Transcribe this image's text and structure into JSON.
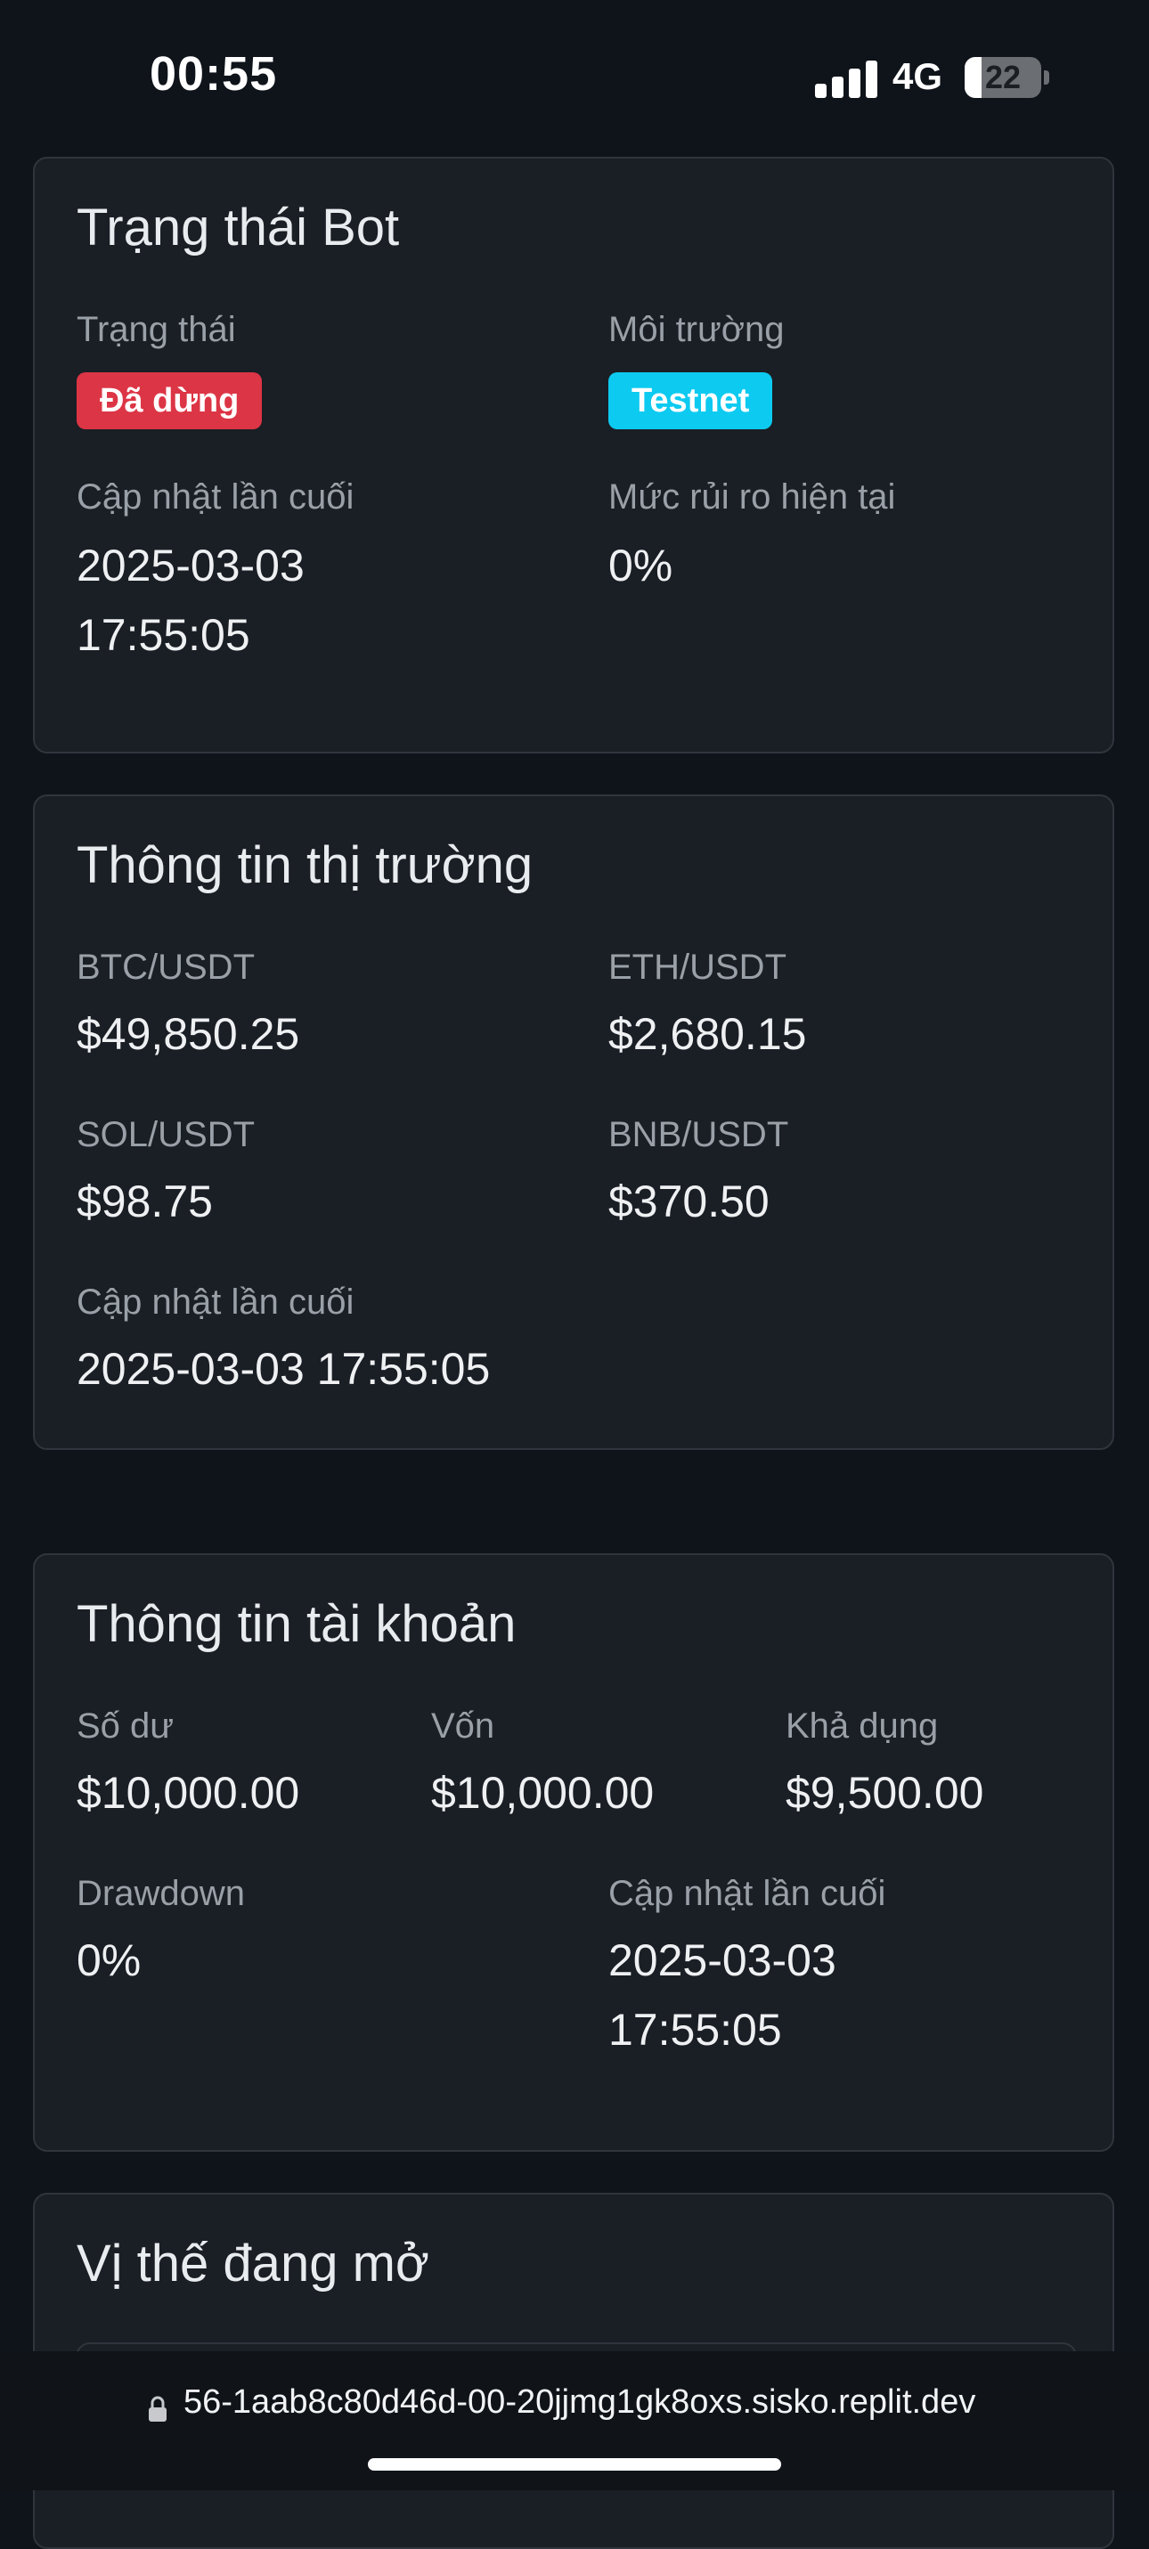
{
  "status_bar": {
    "time": "00:55",
    "network": "4G",
    "battery": "22",
    "battery_level": 0.22,
    "signal_icon": "cellular-signal-icon",
    "battery_icon": "battery-icon"
  },
  "bot_status": {
    "title": "Trạng thái Bot",
    "status_label": "Trạng thái",
    "status_value": "Đã dừng",
    "status_color": "#dc3545",
    "env_label": "Môi trường",
    "env_value": "Testnet",
    "env_color": "#0dcaf0",
    "updated_label": "Cập nhật lần cuối",
    "updated_date": "2025-03-03",
    "updated_time": "17:55:05",
    "risk_label": "Mức rủi ro hiện tại",
    "risk_value": "0%"
  },
  "market": {
    "title": "Thông tin thị trường",
    "pairs": [
      {
        "symbol": "BTC/USDT",
        "price": "$49,850.25"
      },
      {
        "symbol": "ETH/USDT",
        "price": "$2,680.15"
      },
      {
        "symbol": "SOL/USDT",
        "price": "$98.75"
      },
      {
        "symbol": "BNB/USDT",
        "price": "$370.50"
      }
    ],
    "updated_label": "Cập nhật lần cuối",
    "updated_value": "2025-03-03 17:55:05"
  },
  "account": {
    "title": "Thông tin tài khoản",
    "balance_label": "Số dư",
    "balance_value": "$10,000.00",
    "equity_label": "Vốn",
    "equity_value": "$10,000.00",
    "available_label": "Khả dụng",
    "available_value": "$9,500.00",
    "drawdown_label": "Drawdown",
    "drawdown_value": "0%",
    "updated_label": "Cập nhật lần cuối",
    "updated_date": "2025-03-03",
    "updated_time": "17:55:05"
  },
  "positions": {
    "title": "Vị thế đang mở"
  },
  "browser": {
    "url": "56-1aab8c80d46d-00-20jjmg1gk8oxs.sisko.replit.dev",
    "lock_icon": "lock-icon"
  }
}
